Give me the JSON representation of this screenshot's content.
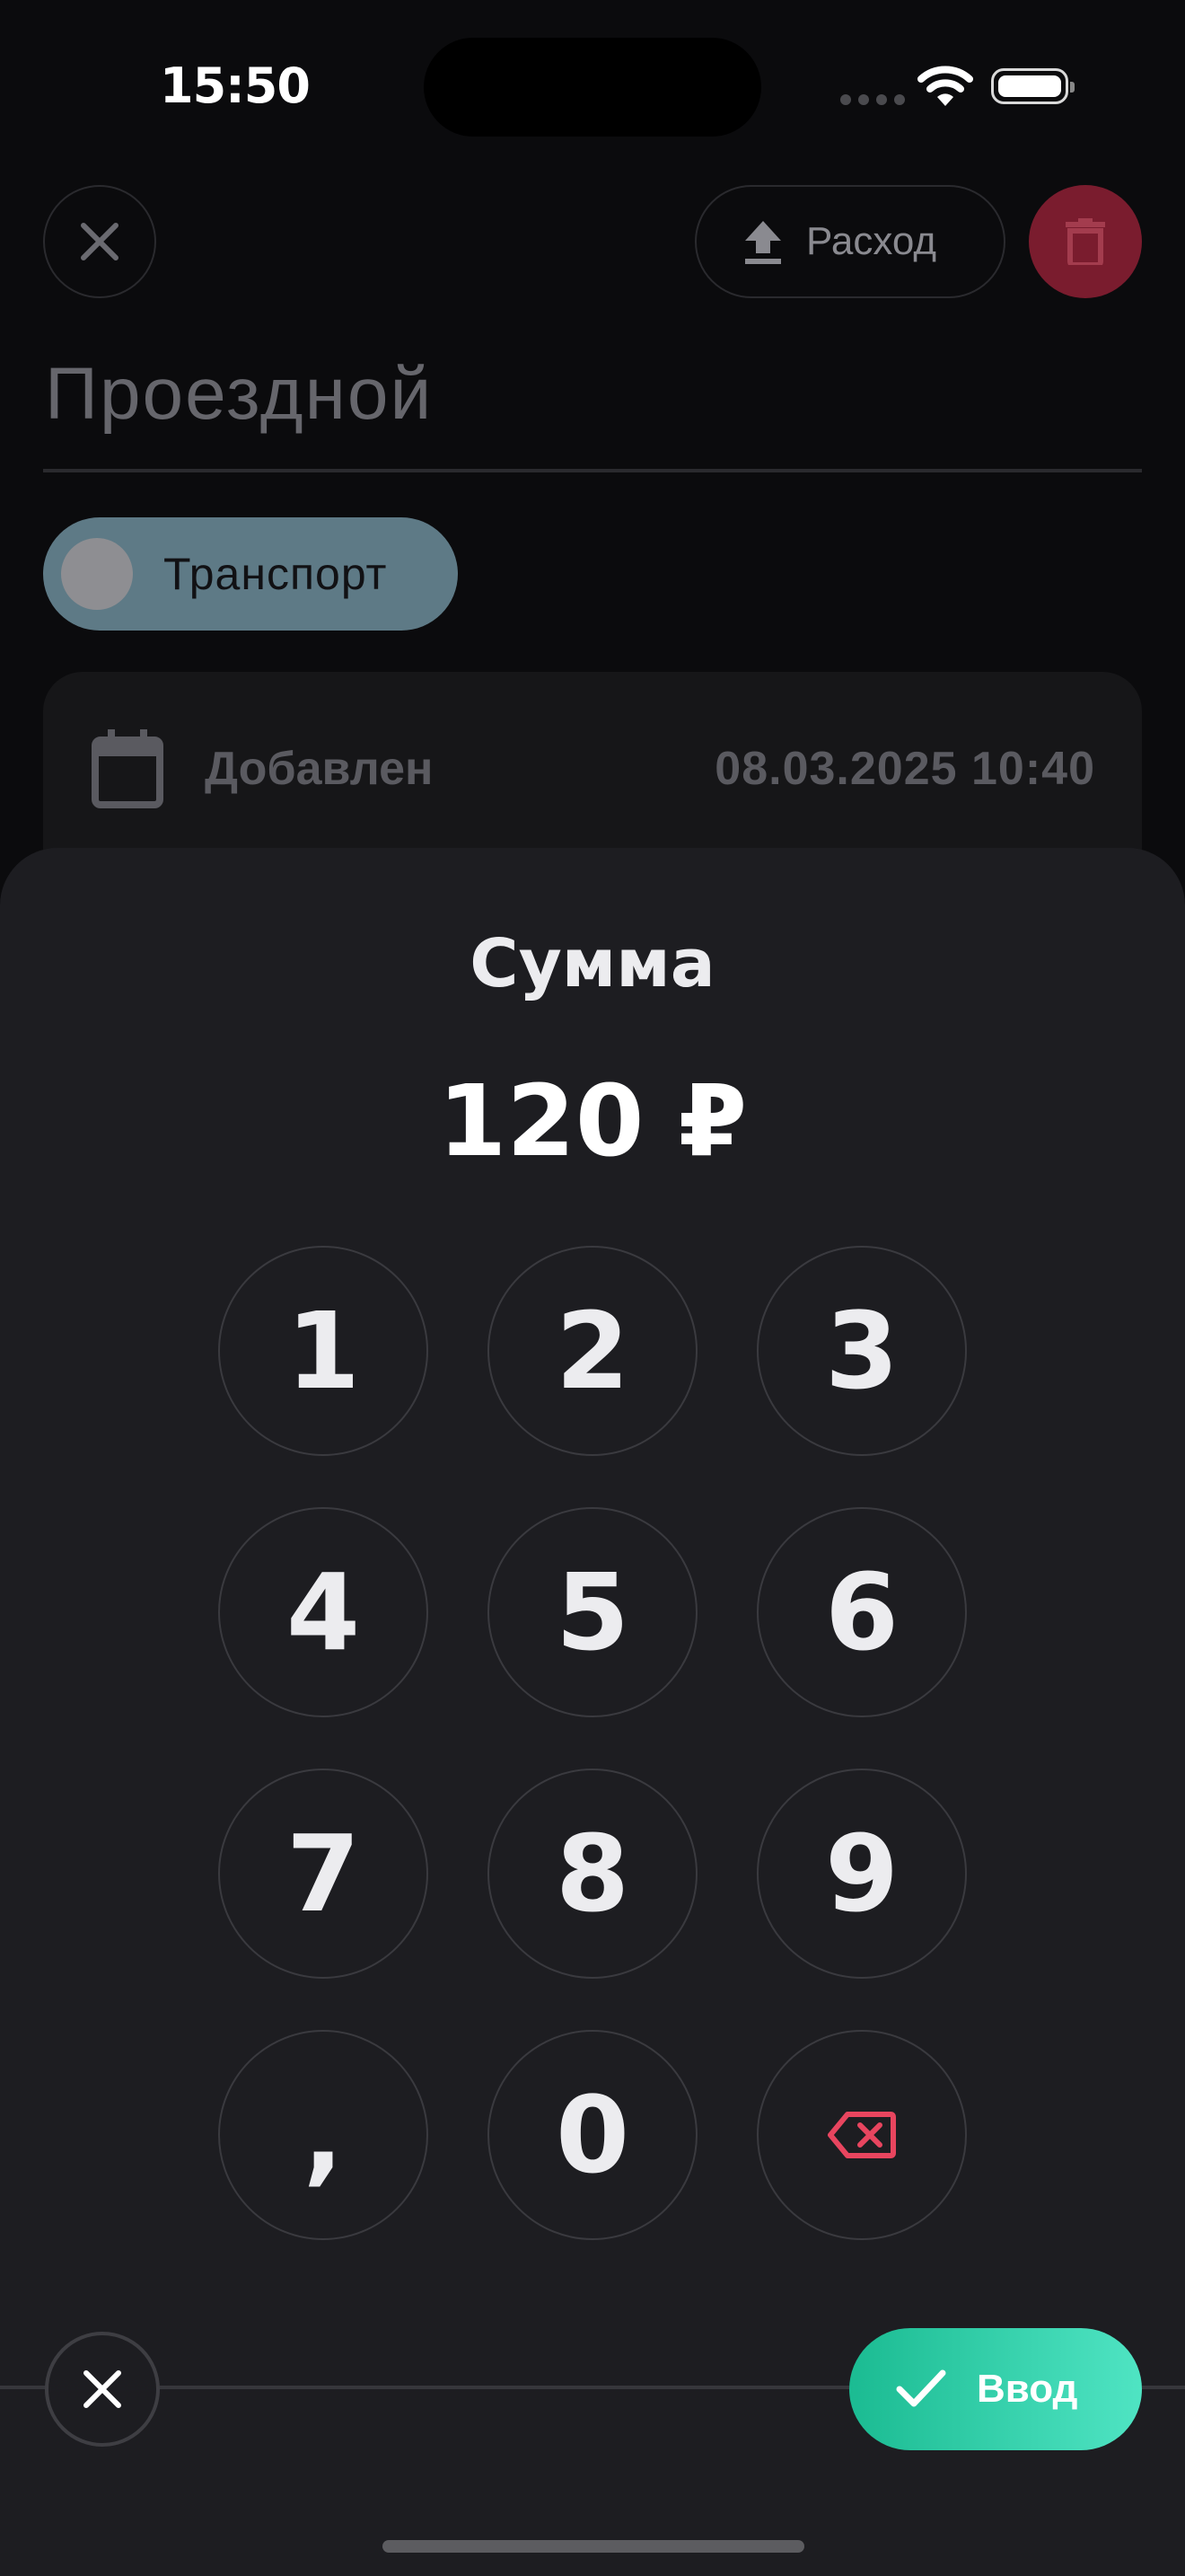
{
  "status_bar": {
    "time": "15:50"
  },
  "header": {
    "type_label": "Расход",
    "title": "Проездной",
    "icons": {
      "close": "close-icon",
      "type": "upload-icon",
      "delete": "trash-icon"
    },
    "colors": {
      "delete_bg": "#7a1c2e"
    }
  },
  "category": {
    "label": "Транспорт",
    "color": "#5e7a86"
  },
  "info": {
    "label": "Добавлен",
    "date": "08.03.2025 10:40",
    "icon": "calendar-icon"
  },
  "keypad_sheet": {
    "title": "Сумма",
    "amount": "120 ₽",
    "keys": [
      "1",
      "2",
      "3",
      "4",
      "5",
      "6",
      "7",
      "8",
      "9",
      ",",
      "0"
    ],
    "backspace_icon": "backspace-icon",
    "backspace_color": "#e8455f"
  },
  "footer": {
    "enter_label": "Ввод",
    "enter_colors": [
      "#1bbb92",
      "#4fe4c3"
    ],
    "close_icon": "close-icon",
    "check_icon": "check-icon"
  }
}
